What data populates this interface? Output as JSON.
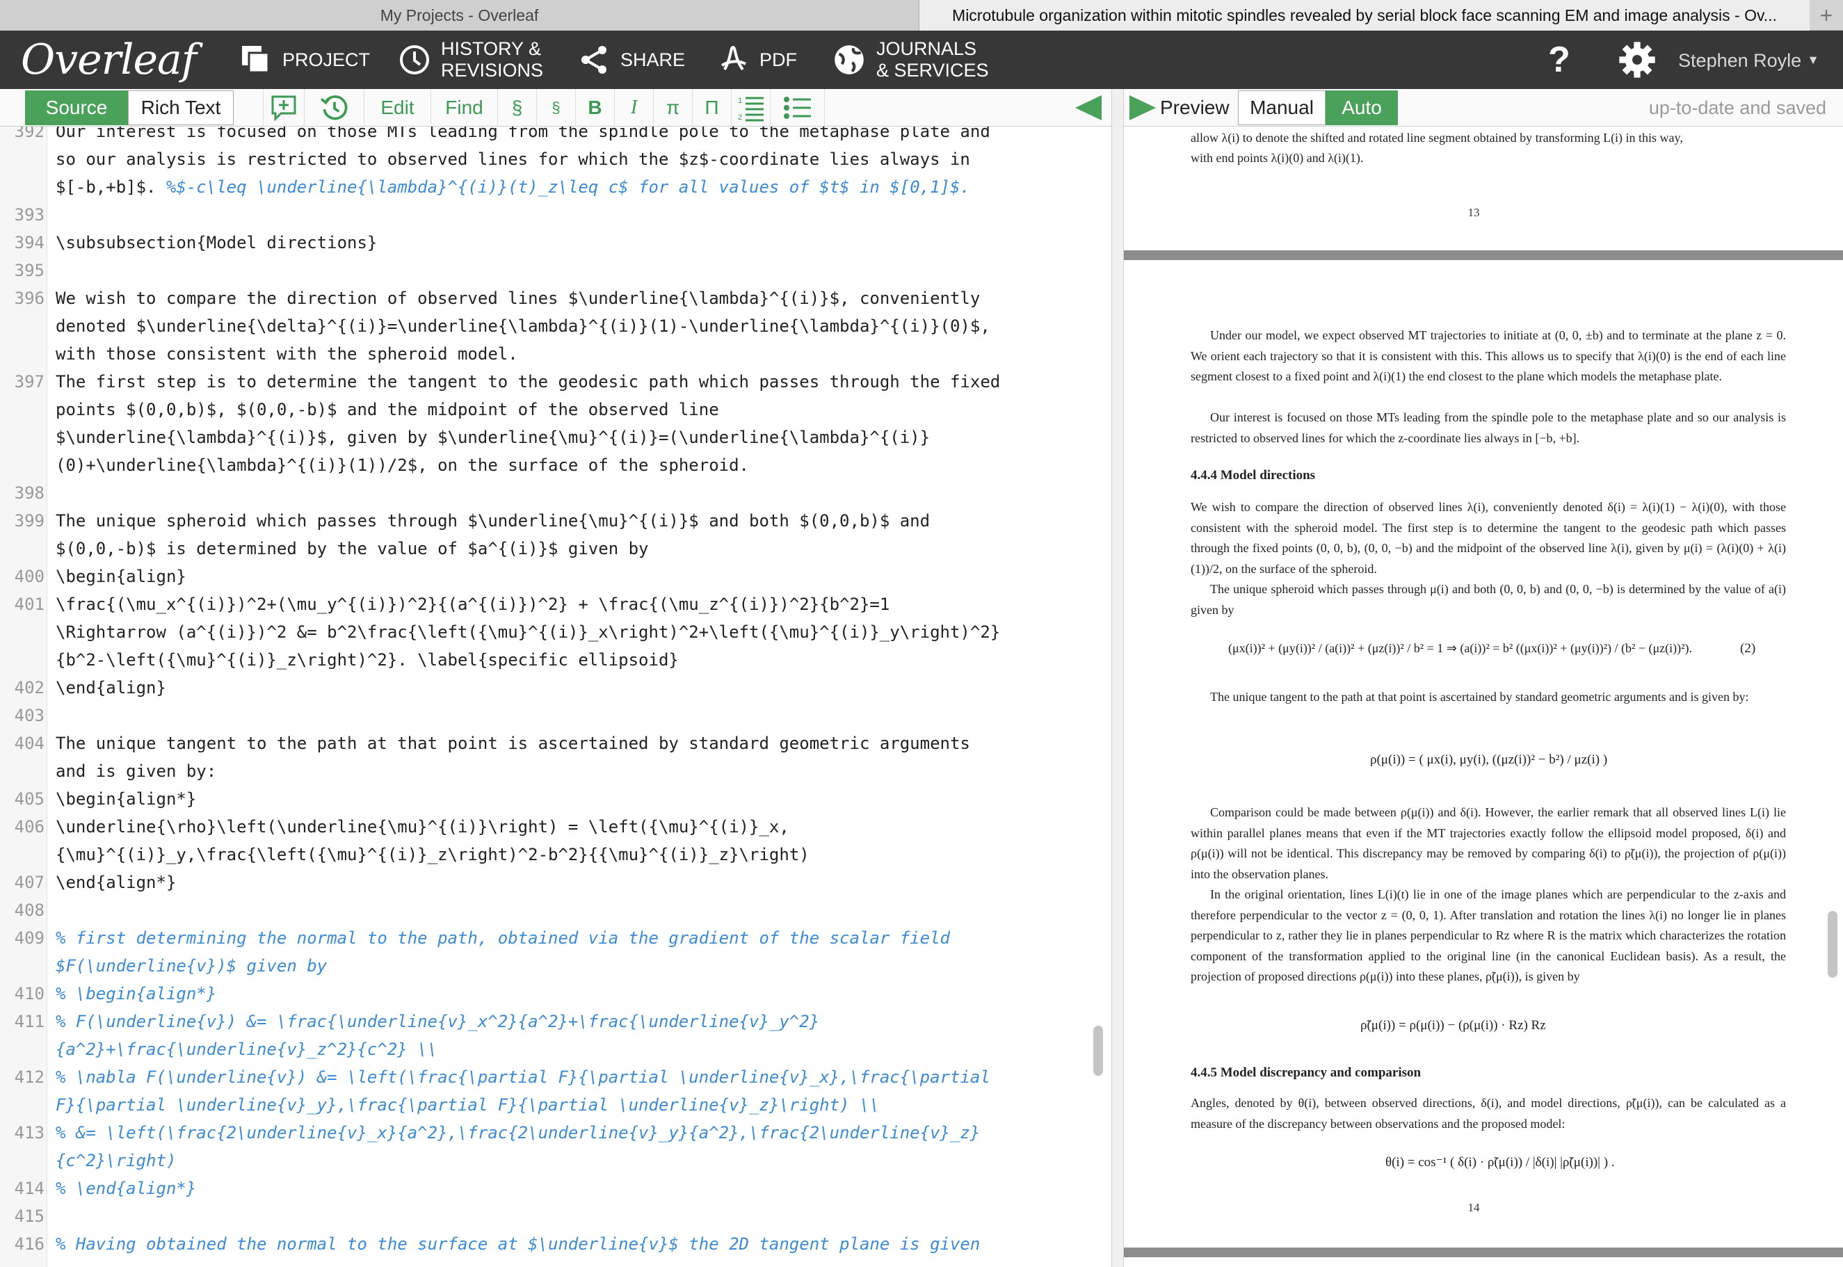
{
  "browser": {
    "tab1": "My Projects - Overleaf",
    "tab2": "Microtubule organization within mitotic spindles revealed by serial block face scanning EM and image analysis - Ov...",
    "new_tab": "+"
  },
  "nav": {
    "logo": "Overleaf",
    "project": "PROJECT",
    "history1": "HISTORY &",
    "history2": "REVISIONS",
    "share": "SHARE",
    "pdf": "PDF",
    "journals1": "JOURNALS",
    "journals2": "& SERVICES",
    "help": "?",
    "user": "Stephen Royle"
  },
  "editor_toolbar": {
    "source": "Source",
    "rich_text": "Rich Text",
    "edit": "Edit",
    "find": "Find",
    "sect1": "§",
    "sect2": "§",
    "bold": "B",
    "italic": "I",
    "pi": "π",
    "cap": "Π"
  },
  "preview_toolbar": {
    "preview": "Preview",
    "manual": "Manual",
    "auto": "Auto",
    "status": "up-to-date and saved"
  },
  "editor": {
    "lines": [
      {
        "n": "392",
        "t": "Our interest is focused on those MTs leading from the spindle pole to the metaphase plate and"
      },
      {
        "n": "",
        "t": "so our analysis is restricted to observed lines for which the $z$-coordinate lies always in"
      },
      {
        "n": "",
        "t": "$[-b,+b]$. ",
        "c": "%$-c\\leq \\underline{\\lambda}^{(i)}(t)_z\\leq c$ for all values of $t$ in $[0,1]$."
      },
      {
        "n": "393",
        "t": ""
      },
      {
        "n": "394",
        "t": "\\subsubsection{Model directions}"
      },
      {
        "n": "395",
        "t": ""
      },
      {
        "n": "396",
        "t": "We wish to compare the direction of observed lines $\\underline{\\lambda}^{(i)}$, conveniently"
      },
      {
        "n": "",
        "t": "denoted $\\underline{\\delta}^{(i)}=\\underline{\\lambda}^{(i)}(1)-\\underline{\\lambda}^{(i)}(0)$,"
      },
      {
        "n": "",
        "t": "with those consistent with the spheroid model."
      },
      {
        "n": "397",
        "t": "The first step is to determine the tangent to the geodesic path which passes through the fixed"
      },
      {
        "n": "",
        "t": "points $(0,0,b)$, $(0,0,-b)$ and the midpoint of the observed line"
      },
      {
        "n": "",
        "t": "$\\underline{\\lambda}^{(i)}$, given by $\\underline{\\mu}^{(i)}=(\\underline{\\lambda}^{(i)}"
      },
      {
        "n": "",
        "t": "(0)+\\underline{\\lambda}^{(i)}(1))/2$, on the surface of the spheroid."
      },
      {
        "n": "398",
        "t": ""
      },
      {
        "n": "399",
        "t": "The unique spheroid which passes through $\\underline{\\mu}^{(i)}$ and both $(0,0,b)$ and"
      },
      {
        "n": "",
        "t": "$(0,0,-b)$ is determined by the value of $a^{(i)}$ given by"
      },
      {
        "n": "400",
        "t": "\\begin{align}"
      },
      {
        "n": "401",
        "t": "\\frac{(\\mu_x^{(i)})^2+(\\mu_y^{(i)})^2}{(a^{(i)})^2} + \\frac{(\\mu_z^{(i)})^2}{b^2}=1"
      },
      {
        "n": "",
        "t": "\\Rightarrow (a^{(i)})^2 &= b^2\\frac{\\left({\\mu}^{(i)}_x\\right)^2+\\left({\\mu}^{(i)}_y\\right)^2}"
      },
      {
        "n": "",
        "t": "{b^2-\\left({\\mu}^{(i)}_z\\right)^2}. \\label{specific ellipsoid}"
      },
      {
        "n": "402",
        "t": "\\end{align}"
      },
      {
        "n": "403",
        "t": ""
      },
      {
        "n": "404",
        "t": "The unique tangent to the path at that point is ascertained by standard geometric arguments"
      },
      {
        "n": "",
        "t": "and is given by:"
      },
      {
        "n": "405",
        "t": "\\begin{align*}"
      },
      {
        "n": "406",
        "t": "\\underline{\\rho}\\left(\\underline{\\mu}^{(i)}\\right) = \\left({\\mu}^{(i)}_x,"
      },
      {
        "n": "",
        "t": "{\\mu}^{(i)}_y,\\frac{\\left({\\mu}^{(i)}_z\\right)^2-b^2}{{\\mu}^{(i)}_z}\\right)"
      },
      {
        "n": "407",
        "t": "\\end{align*}"
      },
      {
        "n": "408",
        "t": ""
      },
      {
        "n": "409",
        "t": "",
        "c": "% first determining the normal to the path, obtained via the gradient of the scalar field"
      },
      {
        "n": "",
        "t": "",
        "c": "$F(\\underline{v})$ given by"
      },
      {
        "n": "410",
        "t": "",
        "c": "% \\begin{align*}"
      },
      {
        "n": "411",
        "t": "",
        "c": "% F(\\underline{v}) &= \\frac{\\underline{v}_x^2}{a^2}+\\frac{\\underline{v}_y^2}"
      },
      {
        "n": "",
        "t": "",
        "c": "{a^2}+\\frac{\\underline{v}_z^2}{c^2} \\\\"
      },
      {
        "n": "412",
        "t": "",
        "c": "% \\nabla F(\\underline{v}) &= \\left(\\frac{\\partial F}{\\partial \\underline{v}_x},\\frac{\\partial"
      },
      {
        "n": "",
        "t": "",
        "c": "F}{\\partial \\underline{v}_y},\\frac{\\partial F}{\\partial \\underline{v}_z}\\right) \\\\"
      },
      {
        "n": "413",
        "t": "",
        "c": "% &= \\left(\\frac{2\\underline{v}_x}{a^2},\\frac{2\\underline{v}_y}{a^2},\\frac{2\\underline{v}_z}"
      },
      {
        "n": "",
        "t": "",
        "c": "{c^2}\\right)"
      },
      {
        "n": "414",
        "t": "",
        "c": "% \\end{align*}"
      },
      {
        "n": "415",
        "t": ""
      },
      {
        "n": "416",
        "t": "",
        "c": "% Having obtained the normal to the surface at $\\underline{v}$ the 2D tangent plane is given"
      }
    ]
  },
  "preview": {
    "top1": "allow λ(i) to denote the shifted and rotated line segment obtained by transforming L(i) in this way,",
    "top2": "with end points λ(i)(0) and λ(i)(1).",
    "page13": "13",
    "p1": "Under our model, we expect observed MT trajectories to initiate at (0, 0, ±b) and to terminate at the plane z = 0. We orient each trajectory so that it is consistent with this. This allows us to specify that λ(i)(0) is the end of each line segment closest to a fixed point and λ(i)(1) the end closest to the plane which models the metaphase plate.",
    "p2": "Our interest is focused on those MTs leading from the spindle pole to the metaphase plate and so our analysis is restricted to observed lines for which the z-coordinate lies always in [−b, +b].",
    "h444": "4.4.4   Model directions",
    "p3": "We wish to compare the direction of observed lines λ(i), conveniently denoted δ(i) = λ(i)(1) − λ(i)(0), with those consistent with the spheroid model. The first step is to determine the tangent to the geodesic path which passes through the fixed points (0, 0, b), (0, 0, −b) and the midpoint of the observed line λ(i), given by μ(i) = (λ(i)(0) + λ(i)(1))/2, on the surface of the spheroid.",
    "p4": "The unique spheroid which passes through μ(i) and both (0, 0, b) and (0, 0, −b) is determined by the value of a(i) given by",
    "eq2": "(μx(i))² + (μy(i))² / (a(i))²  +  (μz(i))² / b²  = 1 ⇒ (a(i))² = b² ((μx(i))² + (μy(i))²) / (b² − (μz(i))²).",
    "eq2num": "(2)",
    "p5": "The unique tangent to the path at that point is ascertained by standard geometric arguments and is given by:",
    "eq3": "ρ(μ(i)) = ( μx(i), μy(i), ((μz(i))² − b²) / μz(i) )",
    "p6": "Comparison could be made between ρ(μ(i)) and δ(i). However, the earlier remark that all observed lines L(i) lie within parallel planes means that even if the MT trajectories exactly follow the ellipsoid model proposed, δ(i) and ρ(μ(i)) will not be identical. This discrepancy may be removed by comparing δ(i) to ρ̃(μ(i)), the projection of ρ(μ(i)) into the observation planes.",
    "p7": "In the original orientation, lines L(i)(t) lie in one of the image planes which are perpendicular to the z-axis and therefore perpendicular to the vector z = (0, 0, 1). After translation and rotation the lines λ(i) no longer lie in planes perpendicular to z, rather they lie in planes perpendicular to Rz where R is the matrix which characterizes the rotation component of the transformation applied to the original line (in the canonical Euclidean basis). As a result, the projection of proposed directions ρ(μ(i)) into these planes, ρ̃(μ(i)), is given by",
    "eq4": "ρ̃(μ(i)) = ρ(μ(i)) − (ρ(μ(i)) · Rz) Rz",
    "h445": "4.4.5   Model discrepancy and comparison",
    "p8": "Angles, denoted by θ(i), between observed directions, δ(i), and model directions, ρ̃(μ(i)), can be calculated as a measure of the discrepancy between observations and the proposed model:",
    "eq5": "θ(i) = cos⁻¹ ( δ(i) · ρ̃(μ(i)) / |δ(i)| |ρ̃(μ(i))| ) .",
    "page14": "14"
  }
}
